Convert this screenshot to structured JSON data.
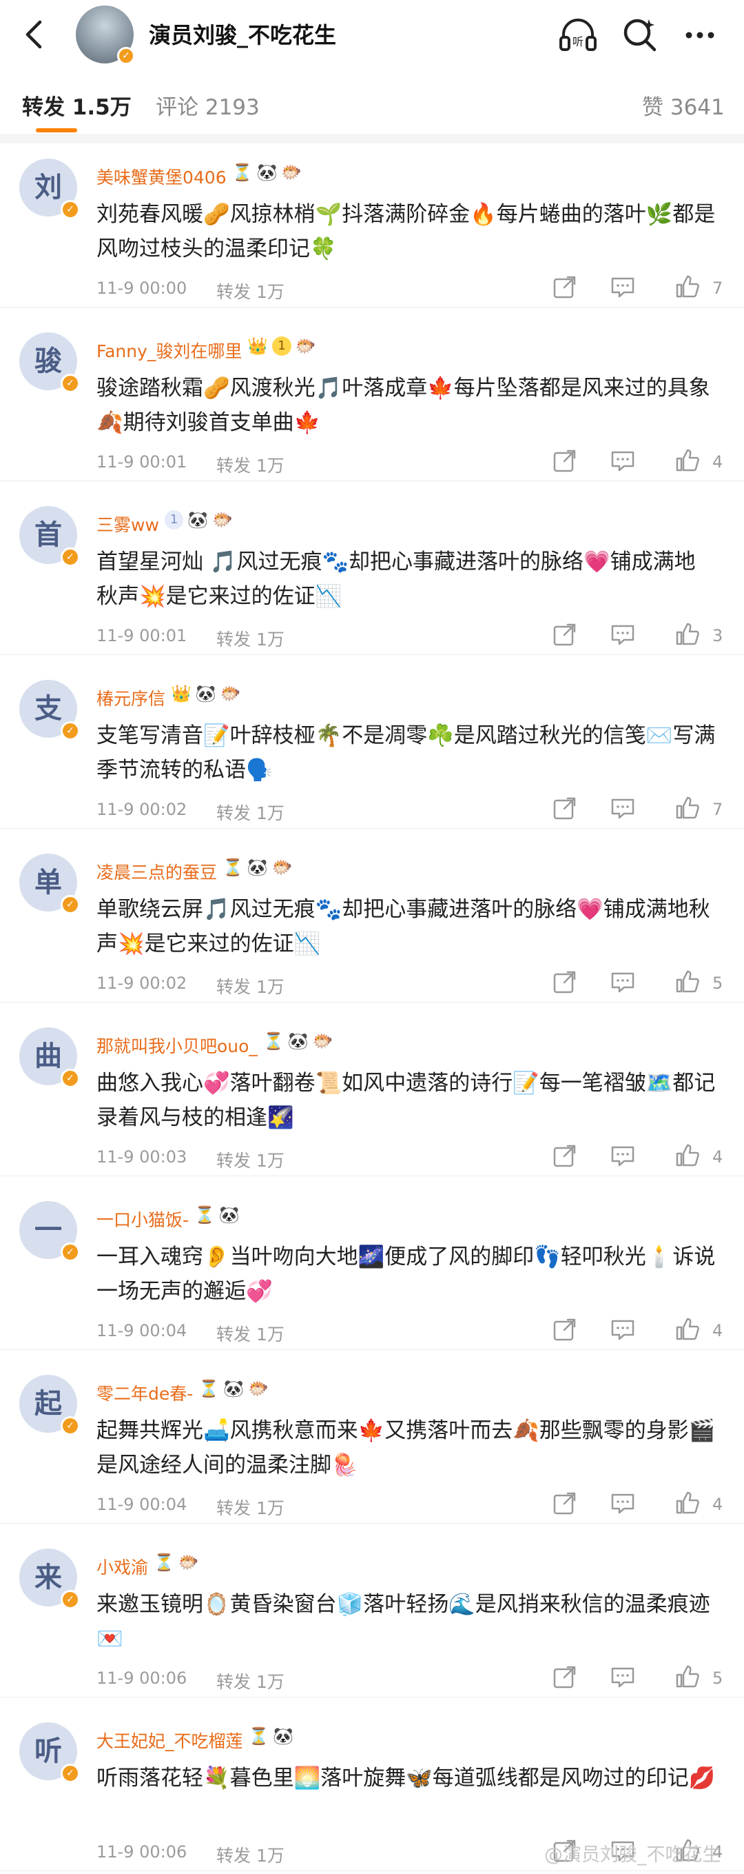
{
  "header": {
    "title": "演员刘骏_不吃花生"
  },
  "tabs": [
    {
      "label": "转发 1.5万",
      "active": true
    },
    {
      "label": "评论 2193",
      "active": false
    },
    {
      "label": "赞 3641",
      "active": false
    }
  ],
  "comments": [
    {
      "avatar": "刘",
      "user": "美味蟹黄堡0406",
      "badges": [
        "⏳",
        "🐼",
        "🐡"
      ],
      "text": "刘苑春风暖🥜风掠林梢🌱抖落满阶碎金🔥每片蜷曲的落叶🌿都是风吻过枝头的温柔印记🍀",
      "time": "11-9 00:00",
      "forward": "转发 1万",
      "likes": "7"
    },
    {
      "avatar": "骏",
      "user": "Fanny_骏刘在哪里",
      "badges": [
        "👑",
        "1",
        "🐡"
      ],
      "text": "骏途踏秋霜🥜风渡秋光🎵叶落成章🍁每片坠落都是风来过的具象🍂期待刘骏首支单曲🍁",
      "time": "11-9 00:01",
      "forward": "转发 1万",
      "likes": "4"
    },
    {
      "avatar": "首",
      "user": "三雾ww",
      "badges": [
        "1",
        "🐼",
        "🐡"
      ],
      "text": "首望星河灿 🎵风过无痕🐾却把心事藏进落叶的脉络💗铺成满地秋声💥是它来过的佐证📉",
      "time": "11-9 00:01",
      "forward": "转发 1万",
      "likes": "3"
    },
    {
      "avatar": "支",
      "user": "椿元序信",
      "badges": [
        "👑",
        "🐼",
        "🐡"
      ],
      "text": "支笔写清音📝叶辞枝桠🌴不是凋零☘️是风踏过秋光的信笺✉️写满季节流转的私语🗣️",
      "time": "11-9 00:02",
      "forward": "转发 1万",
      "likes": "7"
    },
    {
      "avatar": "单",
      "user": "凌晨三点的蚕豆",
      "badges": [
        "⏳",
        "🐼",
        "🐡"
      ],
      "text": "单歌绕云屏🎵风过无痕🐾却把心事藏进落叶的脉络💗铺成满地秋声💥是它来过的佐证📉",
      "time": "11-9 00:02",
      "forward": "转发 1万",
      "likes": "5"
    },
    {
      "avatar": "曲",
      "user": "那就叫我小贝吧ouo_",
      "badges": [
        "⏳",
        "🐼",
        "🐡"
      ],
      "text": "曲悠入我心💞落叶翻卷📜如风中遗落的诗行📝每一笔褶皱🗺️都记录着风与枝的相逢🌠",
      "time": "11-9 00:03",
      "forward": "转发 1万",
      "likes": "4"
    },
    {
      "avatar": "一",
      "user": "一口小猫饭-",
      "badges": [
        "⏳",
        "🐼"
      ],
      "text": "一耳入魂窍👂当叶吻向大地🌌便成了风的脚印👣轻叩秋光🕯️诉说一场无声的邂逅💞",
      "time": "11-9 00:04",
      "forward": "转发 1万",
      "likes": "4"
    },
    {
      "avatar": "起",
      "user": "零二年de春-",
      "badges": [
        "⏳",
        "🐼",
        "🐡"
      ],
      "text": "起舞共辉光🛋️风携秋意而来🍁又携落叶而去🍂那些飘零的身影🎬是风途经人间的温柔注脚🪼",
      "time": "11-9 00:04",
      "forward": "转发 1万",
      "likes": "4"
    },
    {
      "avatar": "来",
      "user": "小戏渝",
      "badges": [
        "⏳",
        "🐡"
      ],
      "text": "来邀玉镜明🪞黄昏染窗台🧊落叶轻扬🌊是风捎来秋信的温柔痕迹💌",
      "time": "11-9 00:06",
      "forward": "转发 1万",
      "likes": "5"
    },
    {
      "avatar": "听",
      "user": "大王妃妃_不吃榴莲",
      "badges": [
        "⏳",
        "🐼"
      ],
      "text": "听雨落花轻💐暮色里🌅落叶旋舞🦋每道弧线都是风吻过的印记💋",
      "time": "11-9 00:06",
      "forward": "转发 1万",
      "likes": "4"
    }
  ],
  "watermark": "@演员刘骏_不吃花生",
  "colors": {
    "accent": "#ff8200",
    "username": "#e86c1a",
    "meta": "#9b9b9b",
    "avatar_bg": "#d7dfee"
  },
  "icons": {
    "back": "chevron-left-icon",
    "listen": "headphones-icon",
    "search": "search-icon",
    "more": "more-dots-icon",
    "share": "share-icon",
    "comment": "comment-icon",
    "like": "thumbs-up-icon"
  }
}
